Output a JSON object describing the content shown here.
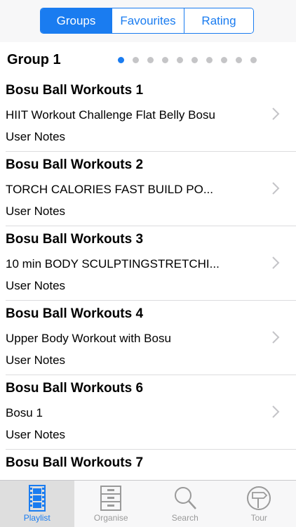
{
  "segmented": {
    "groups": "Groups",
    "favourites": "Favourites",
    "rating": "Rating",
    "selected": "Groups"
  },
  "group": {
    "title": "Group 1",
    "page_count": 10,
    "current_page": 1
  },
  "rows": [
    {
      "title": "Bosu Ball Workouts 1",
      "subtitle": "HIIT Workout Challenge Flat Belly Bosu",
      "notes": "User Notes"
    },
    {
      "title": "Bosu Ball Workouts 2",
      "subtitle": "TORCH CALORIES FAST  BUILD PO...",
      "notes": "User Notes"
    },
    {
      "title": "Bosu Ball Workouts 3",
      "subtitle": "10 min BODY SCULPTINGSTRETCHI...",
      "notes": "User Notes"
    },
    {
      "title": "Bosu Ball Workouts 4",
      "subtitle": "Upper Body Workout with Bosu",
      "notes": "User Notes"
    },
    {
      "title": "Bosu Ball Workouts 6",
      "subtitle": "Bosu 1",
      "notes": "User Notes"
    },
    {
      "title": "Bosu Ball Workouts 7",
      "subtitle": "",
      "notes": ""
    }
  ],
  "tabbar": {
    "playlist": "Playlist",
    "organise": "Organise",
    "search": "Search",
    "tour": "Tour",
    "active": "Playlist"
  },
  "icons": {
    "playlist": "film-strip-icon",
    "organise": "cabinet-icon",
    "search": "magnifier-icon",
    "tour": "signpost-icon",
    "chevron": "chevron-right-icon"
  },
  "colors": {
    "accent": "#1a7cf0",
    "inactive_tab": "#9a9a9a",
    "dot_inactive": "#c5c5c7"
  }
}
